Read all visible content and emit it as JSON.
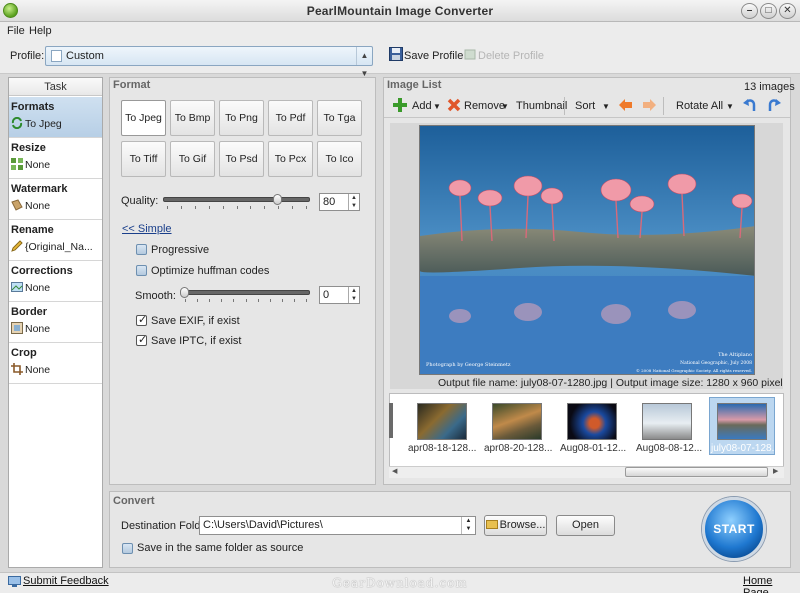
{
  "window": {
    "title": "PearlMountain Image Converter"
  },
  "menu": [
    {
      "label": "File"
    },
    {
      "label": "Help"
    }
  ],
  "profile": {
    "label": "Profile:",
    "value": "Custom",
    "save_label": "Save Profile",
    "delete_label": "Delete Profile"
  },
  "task": {
    "header": "Task",
    "groups": [
      {
        "title": "Formats",
        "value": "To Jpeg",
        "icon": "convert-icon"
      },
      {
        "title": "Resize",
        "value": "None",
        "icon": "resize-icon"
      },
      {
        "title": "Watermark",
        "value": "None",
        "icon": "watermark-icon"
      },
      {
        "title": "Rename",
        "value": "{Original_Na...",
        "icon": "pencil-icon"
      },
      {
        "title": "Corrections",
        "value": "None",
        "icon": "corrections-icon"
      },
      {
        "title": "Border",
        "value": "None",
        "icon": "border-icon"
      },
      {
        "title": "Crop",
        "value": "None",
        "icon": "crop-icon"
      }
    ]
  },
  "format": {
    "title": "Format",
    "buttons": [
      "To Jpeg",
      "To Bmp",
      "To Png",
      "To Pdf",
      "To Tga",
      "To Tiff",
      "To Gif",
      "To Psd",
      "To Pcx",
      "To Ico"
    ],
    "selected": "To Jpeg",
    "quality_label": "Quality:",
    "quality_value": "80",
    "quality_fraction": 0.8,
    "simple_link": "<< Simple",
    "progressive_label": "Progressive",
    "optimize_label": "Optimize huffman codes",
    "smooth_label": "Smooth:",
    "smooth_value": "0",
    "exif_label": "Save EXIF, if exist",
    "iptc_label": "Save IPTC, if exist"
  },
  "image_list": {
    "title": "Image List",
    "count": "13 images",
    "toolbar": {
      "add": "Add",
      "remove": "Remove",
      "thumbnail": "Thumbnail",
      "sort": "Sort",
      "rotate_all": "Rotate All"
    },
    "photo_credit_left": "Photograph by George Steinmetz",
    "photo_credit_right_1": "The Altiplano",
    "photo_credit_right_2": "National Geographic, July 2008",
    "photo_credit_right_3": "© 2008 National Geographic Society. All rights reserved.",
    "output_info": "Output file name: july08-07-1280.jpg | Output image size: 1280 x 960 pixel",
    "thumbnails": [
      {
        "label": "apr08-18-128..."
      },
      {
        "label": "apr08-20-128..."
      },
      {
        "label": "Aug08-01-12..."
      },
      {
        "label": "Aug08-08-12..."
      },
      {
        "label": "july08-07-128..."
      }
    ]
  },
  "convert": {
    "title": "Convert",
    "destination_label": "Destination Folder:",
    "destination_value": "C:\\Users\\David\\Pictures\\",
    "browse_label": "Browse...",
    "open_label": "Open",
    "same_folder_label": "Save in the same folder as source",
    "start_label": "START"
  },
  "status": {
    "feedback_label": "Submit Feedback",
    "homepage_label": "Home Page",
    "watermark": "GearDownload.com"
  },
  "colors": {
    "accent": "#1f78d0",
    "selected_task": "#b7cfe6",
    "link": "#1a3f8b"
  }
}
